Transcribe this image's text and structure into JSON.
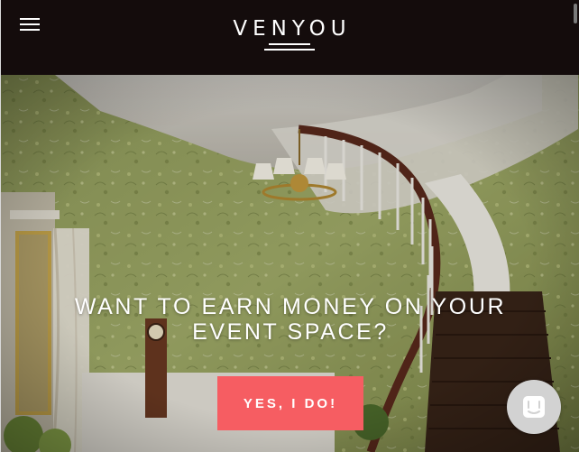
{
  "header": {
    "menu_icon": "hamburger-menu-icon",
    "logo_text": "VENYOU",
    "background": "#140c0c"
  },
  "hero": {
    "headline": "WANT TO EARN MONEY ON YOUR EVENT SPACE?",
    "cta_label": "YES, I DO!",
    "cta_color": "#f65d62",
    "background_image": "staircase-foyer-photo"
  },
  "chat_widget": {
    "icon": "chat-icon"
  }
}
